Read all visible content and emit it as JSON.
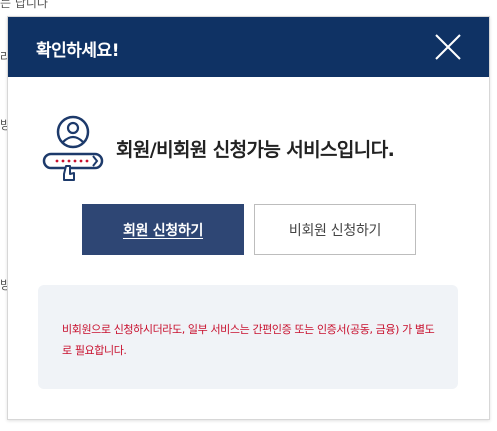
{
  "background": {
    "top_fragment": "는 답니다",
    "line1": "라",
    "line2": "방",
    "line3": "방"
  },
  "modal": {
    "title": "확인하세요!",
    "close_icon": "close-icon",
    "message": "회원/비회원 신청가능 서비스입니다.",
    "member_icon": "member-search-icon",
    "buttons": {
      "member_apply": "회원 신청하기",
      "guest_apply": "비회원 신청하기"
    },
    "notice": "비회원으로 신청하시더라도, 일부 서비스는 간편인증 또는 인증서(공동, 금융) 가 별도로 필요합니다.",
    "colors": {
      "header_bg": "#0f3264",
      "primary_button": "#2e4674",
      "notice_text": "#c8102e",
      "notice_bg": "#f0f3f7"
    }
  }
}
